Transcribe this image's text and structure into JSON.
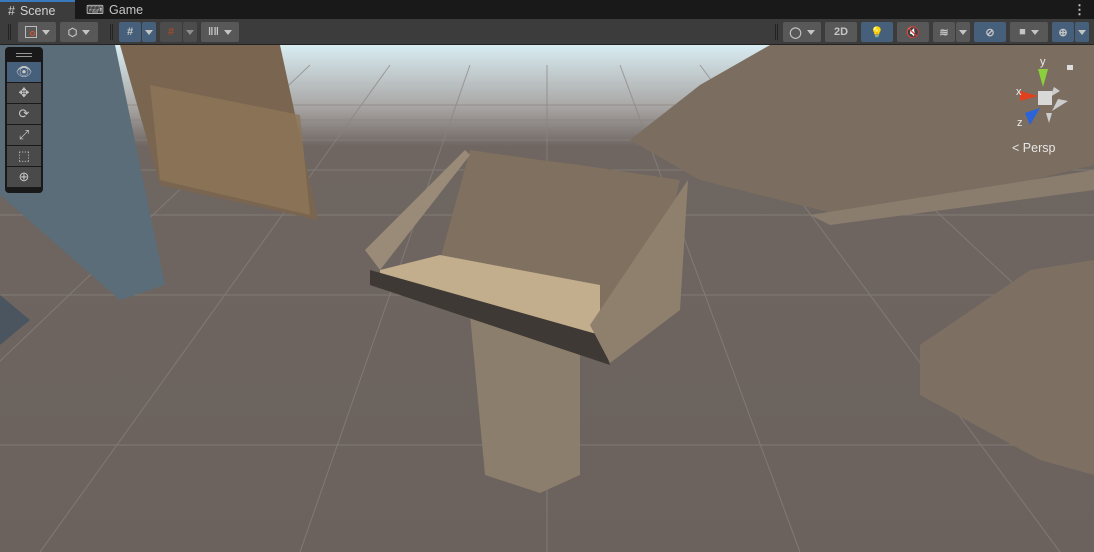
{
  "tabs": [
    {
      "label": "Scene",
      "icon": "grid-hash-icon",
      "active": true
    },
    {
      "label": "Game",
      "icon": "gamepad-icon",
      "active": false
    }
  ],
  "toolbar": {
    "two_d_label": "2D",
    "more_icon": "⋮"
  },
  "gizmo": {
    "x_label": "x",
    "y_label": "y",
    "z_label": "z",
    "projection": "Persp"
  },
  "tools": [
    "view",
    "move",
    "rotate",
    "scale",
    "rect",
    "transform"
  ],
  "colors": {
    "accent": "#46607c",
    "ground": "#6e6560",
    "sky": "#dfeef2"
  }
}
